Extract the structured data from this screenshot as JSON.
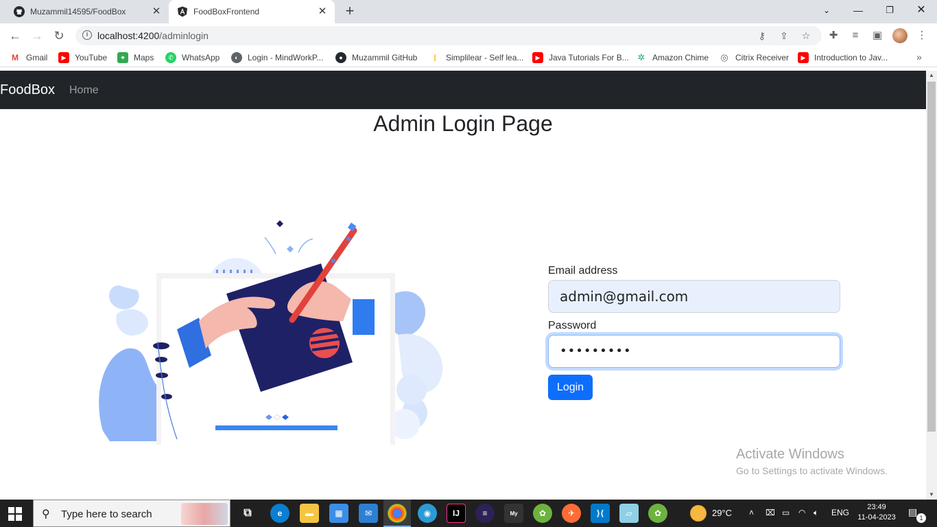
{
  "browser": {
    "tabs": [
      {
        "title": "Muzammil14595/FoodBox",
        "icon": "github-icon"
      },
      {
        "title": "FoodBoxFrontend",
        "icon": "angular-icon"
      }
    ],
    "url_host": "localhost:4200",
    "url_path": "/adminlogin",
    "bookmarks": [
      {
        "label": "Gmail",
        "icon": "gmail-icon",
        "color": "#ea4335"
      },
      {
        "label": "YouTube",
        "icon": "youtube-icon",
        "color": "#ff0000"
      },
      {
        "label": "Maps",
        "icon": "maps-icon",
        "color": "#34a853"
      },
      {
        "label": "WhatsApp",
        "icon": "whatsapp-icon",
        "color": "#25d366"
      },
      {
        "label": "Login - MindWorkP...",
        "icon": "globe-icon",
        "color": "#5f6368"
      },
      {
        "label": "Muzammil GitHub",
        "icon": "github-icon",
        "color": "#24292f"
      },
      {
        "label": "Simplilear - Self lea...",
        "icon": "simplilearn-icon",
        "color": "#f4b400"
      },
      {
        "label": "Java Tutorials For B...",
        "icon": "youtube-icon",
        "color": "#ff0000"
      },
      {
        "label": "Amazon Chime",
        "icon": "chime-icon",
        "color": "#1ea78a"
      },
      {
        "label": "Citrix Receiver",
        "icon": "citrix-icon",
        "color": "#5f6368"
      },
      {
        "label": "Introduction to Jav...",
        "icon": "youtube-icon",
        "color": "#ff0000"
      }
    ]
  },
  "app": {
    "brand": "FoodBox",
    "nav_home": "Home",
    "page_title": "Admin Login Page",
    "email_label": "Email address",
    "email_value": "admin@gmail.com",
    "password_label": "Password",
    "password_value": "•••••••••",
    "login_button": "Login",
    "colors": {
      "navbar": "#212529",
      "primary": "#0d6efd"
    }
  },
  "watermark": {
    "line1": "Activate Windows",
    "line2": "Go to Settings to activate Windows."
  },
  "taskbar": {
    "search_placeholder": "Type here to search",
    "weather": "29°C",
    "language": "ENG",
    "time": "23:49",
    "date": "11-04-2023",
    "notification_count": "1"
  }
}
